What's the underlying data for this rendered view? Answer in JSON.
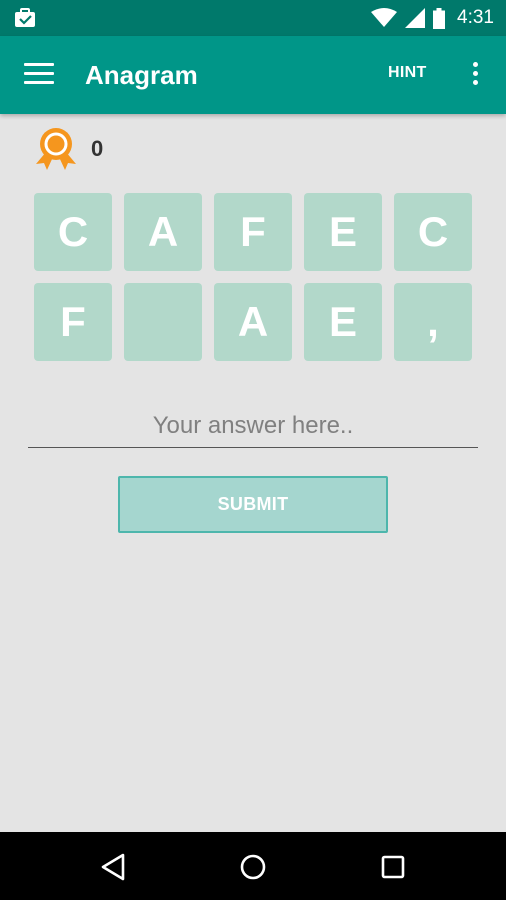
{
  "status_bar": {
    "time": "4:31",
    "icons": [
      "notification-icon",
      "wifi-icon",
      "cell-signal-icon",
      "battery-icon"
    ]
  },
  "app_bar": {
    "title": "Anagram",
    "hint_label": "HINT",
    "icons": [
      "menu-icon",
      "overflow-menu-icon"
    ]
  },
  "score": {
    "value": "0",
    "icon": "medal-icon"
  },
  "tiles": {
    "row1": [
      "C",
      "A",
      "F",
      "E",
      "C"
    ],
    "row2": [
      "F",
      "",
      "A",
      "E",
      ","
    ]
  },
  "answer": {
    "placeholder": "Your answer here..",
    "value": ""
  },
  "submit": {
    "label": "SUBMIT"
  },
  "nav_bar": {
    "icons": [
      "back-icon",
      "home-icon",
      "recents-icon"
    ]
  },
  "colors": {
    "status_bar": "#00796b",
    "app_bar": "#009688",
    "tile": "#b2d8ca",
    "submit_bg": "#a5d6cf",
    "submit_border": "#4db6ac",
    "medal": "#f5961e",
    "background": "#e4e4e4"
  }
}
